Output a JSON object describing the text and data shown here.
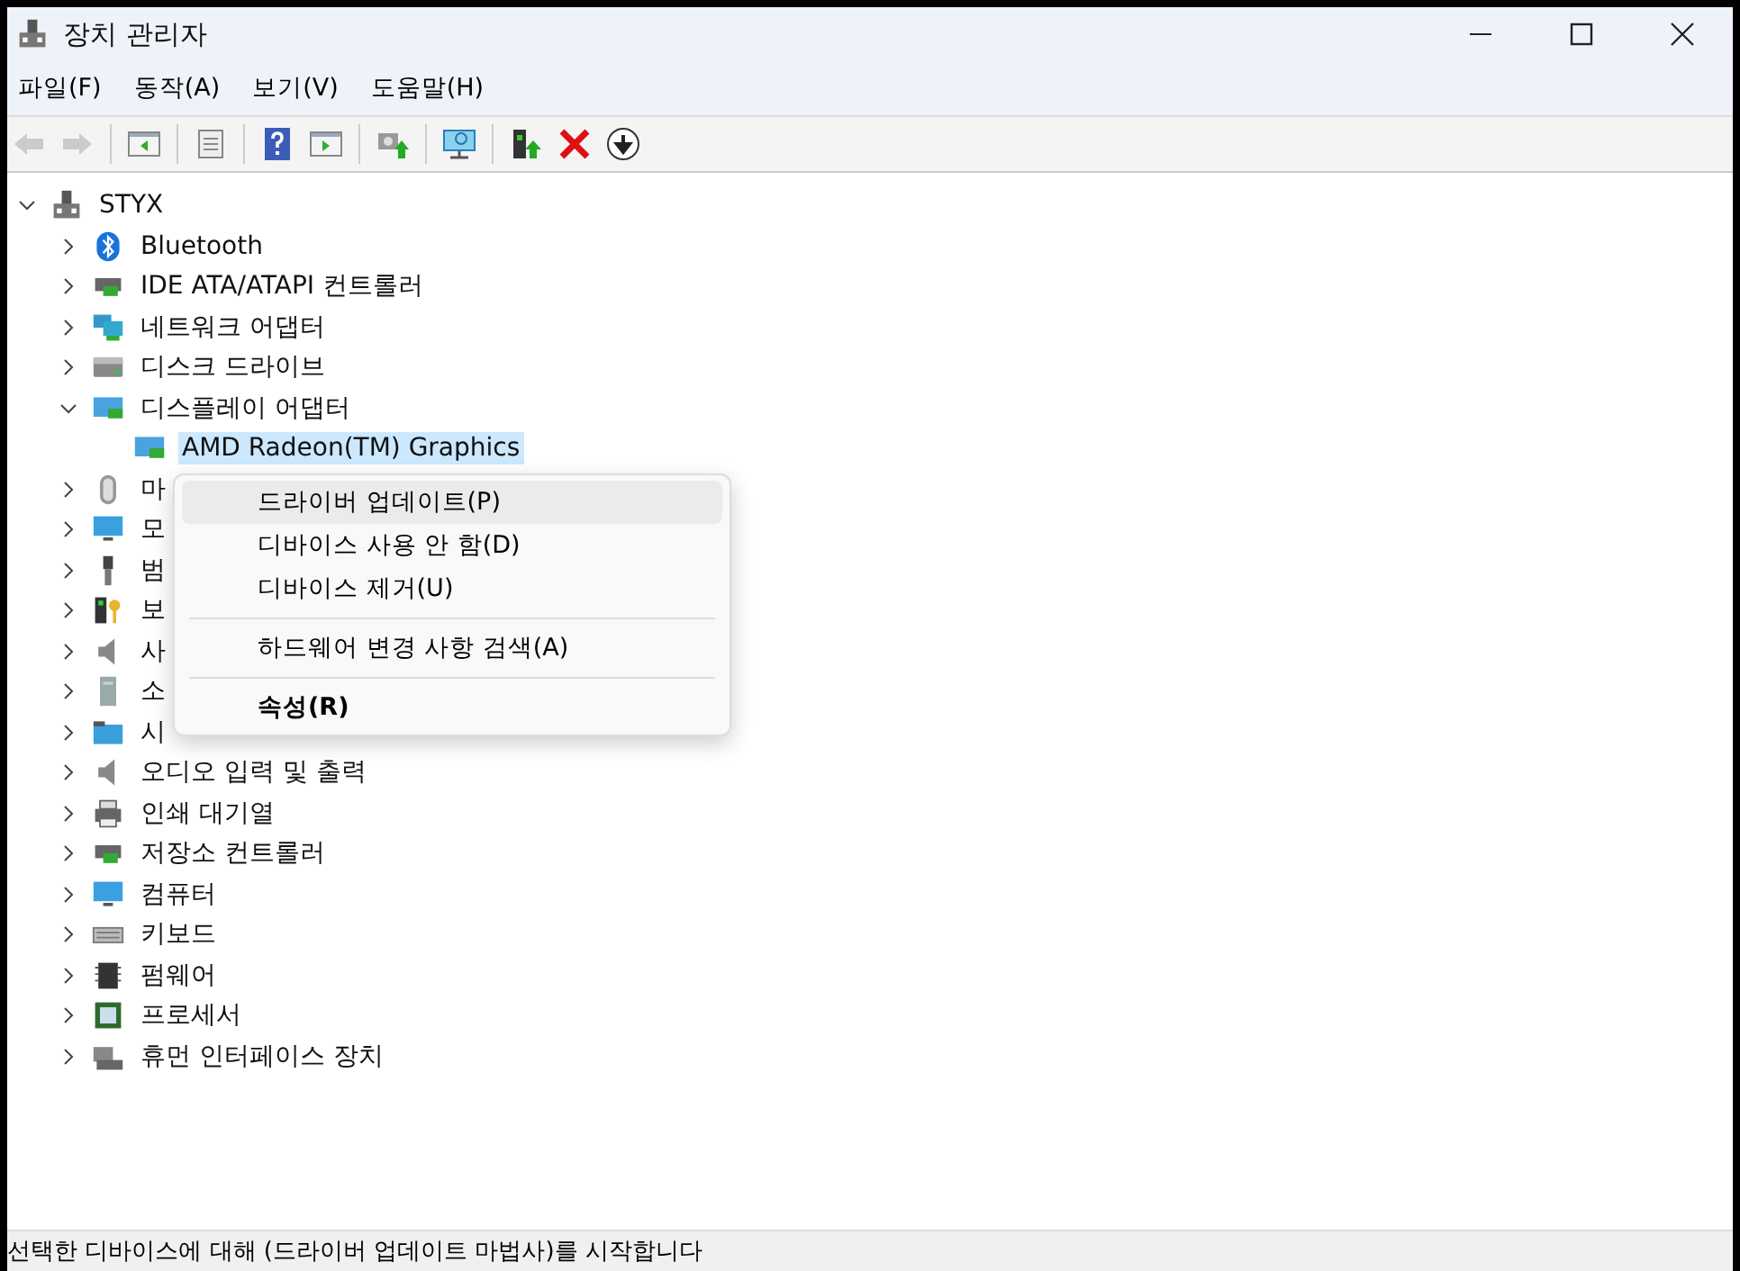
{
  "window": {
    "title": "장치 관리자"
  },
  "menu": [
    "파일(F)",
    "동작(A)",
    "보기(V)",
    "도움말(H)"
  ],
  "toolbar": [
    {
      "kind": "back",
      "disabled": true
    },
    {
      "kind": "forward",
      "disabled": true
    },
    {
      "kind": "sep"
    },
    {
      "kind": "panel-left",
      "disabled": false
    },
    {
      "kind": "sep"
    },
    {
      "kind": "sheet",
      "disabled": false
    },
    {
      "kind": "sep"
    },
    {
      "kind": "help",
      "disabled": false
    },
    {
      "kind": "panel-right",
      "disabled": false
    },
    {
      "kind": "sep"
    },
    {
      "kind": "update",
      "disabled": false
    },
    {
      "kind": "sep"
    },
    {
      "kind": "scan",
      "disabled": false
    },
    {
      "kind": "sep"
    },
    {
      "kind": "enable",
      "disabled": false
    },
    {
      "kind": "remove",
      "disabled": false
    },
    {
      "kind": "download",
      "disabled": false
    }
  ],
  "tree": {
    "label": "STYX",
    "kind": "computer",
    "expanded": true,
    "children": [
      {
        "label": "Bluetooth",
        "kind": "bluetooth",
        "expanded": false
      },
      {
        "label": "IDE ATA/ATAPI 컨트롤러",
        "kind": "controller",
        "expanded": false
      },
      {
        "label": "네트워크 어댑터",
        "kind": "network",
        "expanded": false
      },
      {
        "label": "디스크 드라이브",
        "kind": "disk",
        "expanded": false
      },
      {
        "label": "디스플레이 어댑터",
        "kind": "display",
        "expanded": true,
        "children": [
          {
            "label": "AMD Radeon(TM) Graphics",
            "kind": "display",
            "selected": true
          }
        ]
      },
      {
        "label": "마",
        "kind": "mouse",
        "expanded": false
      },
      {
        "label": "모",
        "kind": "monitor",
        "expanded": false
      },
      {
        "label": "범",
        "kind": "usb",
        "expanded": false
      },
      {
        "label": "보",
        "kind": "security",
        "expanded": false
      },
      {
        "label": "사",
        "kind": "speaker",
        "expanded": false
      },
      {
        "label": "소",
        "kind": "tower",
        "expanded": false
      },
      {
        "label": "시",
        "kind": "system",
        "expanded": false
      },
      {
        "label": "오디오 입력 및 출력",
        "kind": "speaker",
        "expanded": false
      },
      {
        "label": "인쇄 대기열",
        "kind": "printer",
        "expanded": false
      },
      {
        "label": "저장소 컨트롤러",
        "kind": "storage",
        "expanded": false
      },
      {
        "label": "컴퓨터",
        "kind": "monitor",
        "expanded": false
      },
      {
        "label": "키보드",
        "kind": "keyboard",
        "expanded": false
      },
      {
        "label": "펌웨어",
        "kind": "chip",
        "expanded": false
      },
      {
        "label": "프로세서",
        "kind": "cpu",
        "expanded": false
      },
      {
        "label": "휴먼 인터페이스 장치",
        "kind": "hid",
        "expanded": false
      }
    ]
  },
  "context_menu": [
    {
      "kind": "item",
      "label": "드라이버 업데이트(P)",
      "selected": true,
      "bold": false
    },
    {
      "kind": "item",
      "label": "디바이스 사용 안 함(D)",
      "selected": false,
      "bold": false
    },
    {
      "kind": "item",
      "label": "디바이스 제거(U)",
      "selected": false,
      "bold": false
    },
    {
      "kind": "separator"
    },
    {
      "kind": "item",
      "label": "하드웨어 변경 사항 검색(A)",
      "selected": false,
      "bold": false
    },
    {
      "kind": "separator"
    },
    {
      "kind": "item",
      "label": "속성(R)",
      "selected": false,
      "bold": true
    }
  ],
  "status_bar": "선택한 디바이스에 대해 (드라이버 업데이트 마법사)를 시작합니다"
}
